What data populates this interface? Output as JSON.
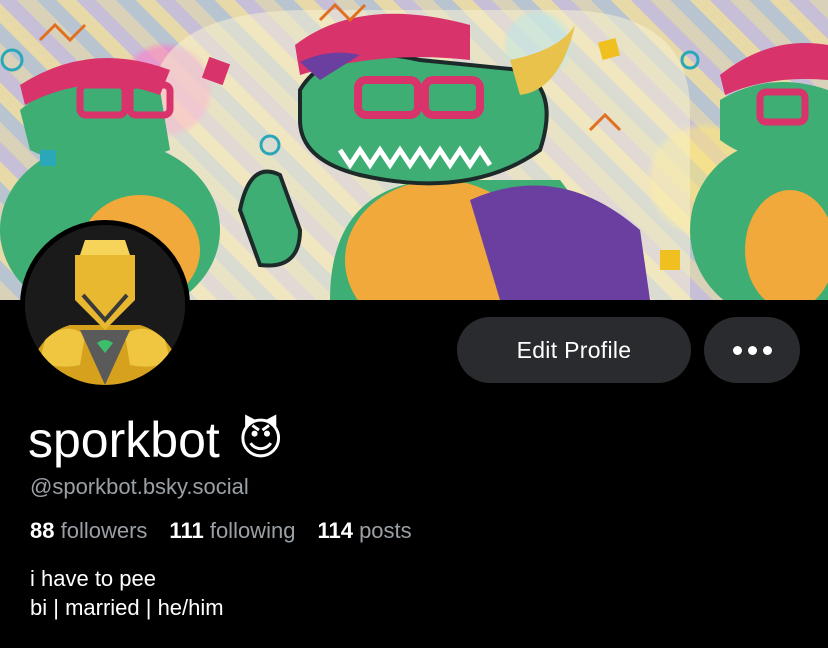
{
  "profile": {
    "display_name": "sporkbot",
    "emoji": "😈",
    "handle": "@sporkbot.bsky.social",
    "edit_label": "Edit Profile",
    "stats": {
      "followers_count": "88",
      "followers_label": "followers",
      "following_count": "111",
      "following_label": "following",
      "posts_count": "114",
      "posts_label": "posts"
    },
    "bio": {
      "line1": "i have to pee",
      "line2": "bi | married | he/him"
    }
  },
  "icons": {
    "more": "more-horizontal-icon"
  },
  "colors": {
    "background": "#000000",
    "button": "#2a2b2e",
    "muted_text": "#9aa0a6"
  }
}
